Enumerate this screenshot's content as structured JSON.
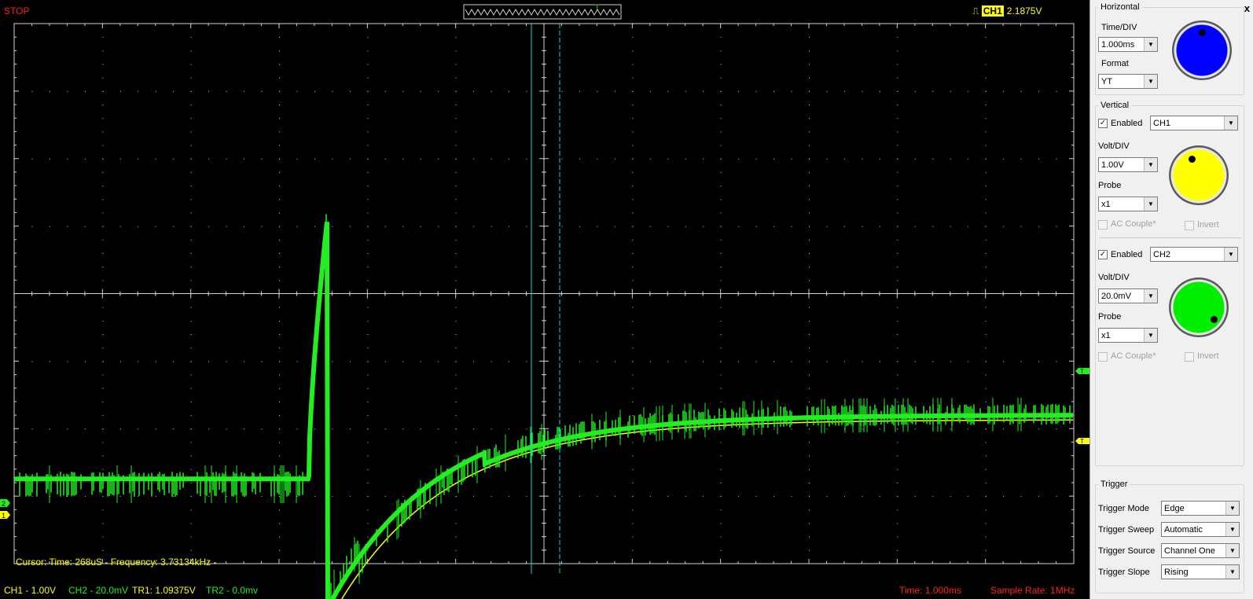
{
  "status": "STOP",
  "trigger_readout": {
    "channel": "CH1",
    "level": "2.1875V"
  },
  "cursor_info": "Cursor: Time: 268uS - Frequency: 3.73134kHz -",
  "bottom_bar": {
    "ch1": "CH1 - 1.00V",
    "ch2": "CH2 - 20.0mV",
    "tr1": "TR1: 1.09375V",
    "tr2": "TR2 - 0.0mv",
    "time": "Time: 1.000ms",
    "sample_rate": "Sample Rate: 1MHz"
  },
  "colors": {
    "ch1": "#ffff00",
    "ch2": "#22ee22",
    "cursor": "#00e0e0",
    "status": "#ff2020",
    "grid": "#d0d0d0"
  },
  "markers": {
    "ch2": "2",
    "ch1": "1",
    "trigger": "T"
  },
  "panel": {
    "close": "x",
    "horizontal": {
      "title": "Horizontal",
      "time_div_label": "Time/DIV",
      "time_div_value": "1.000ms",
      "format_label": "Format",
      "format_value": "YT",
      "knob_color": "#0000ff"
    },
    "vertical": {
      "title": "Vertical",
      "ch1": {
        "enabled_label": "Enabled",
        "enabled": true,
        "channel": "CH1",
        "volt_div_label": "Volt/DIV",
        "volt_div_value": "1.00V",
        "probe_label": "Probe",
        "probe_value": "x1",
        "ac_couple_label": "AC Couple*",
        "invert_label": "Invert",
        "knob_color": "#ffff00"
      },
      "ch2": {
        "enabled_label": "Enabled",
        "enabled": true,
        "channel": "CH2",
        "volt_div_label": "Volt/DIV",
        "volt_div_value": "20.0mV",
        "probe_label": "Probe",
        "probe_value": "x1",
        "ac_couple_label": "AC Couple*",
        "invert_label": "Invert",
        "knob_color": "#00ee00"
      }
    },
    "trigger": {
      "title": "Trigger",
      "mode_label": "Trigger Mode",
      "mode_value": "Edge",
      "sweep_label": "Trigger Sweep",
      "sweep_value": "Automatic",
      "source_label": "Trigger Source",
      "source_value": "Channel One",
      "slope_label": "Trigger Slope",
      "slope_value": "Rising"
    }
  }
}
